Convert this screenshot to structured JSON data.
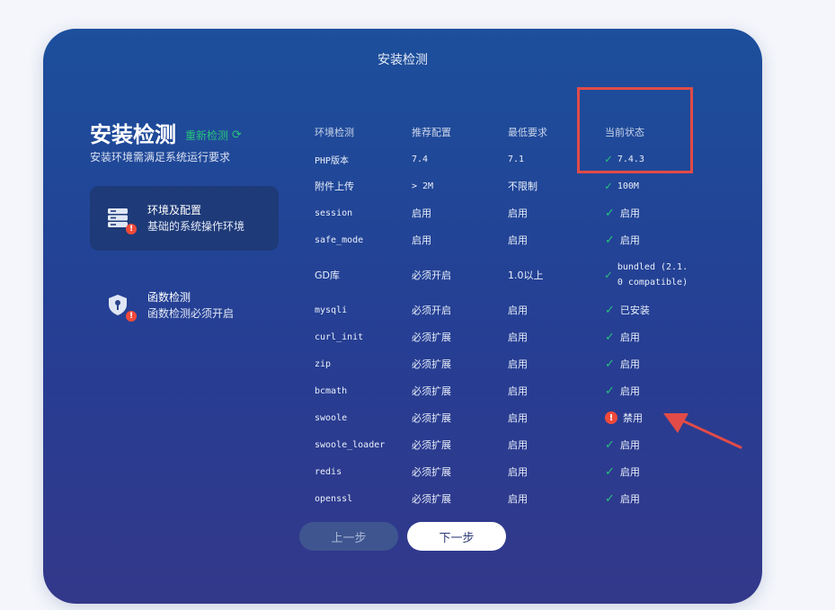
{
  "window_title": "安装检测",
  "main_title": "安装检测",
  "recheck_label": "重新检测",
  "recheck_icon": "refresh-icon",
  "subtitle": "安装环境需满足系统运行要求",
  "steps": [
    {
      "title": "环境及配置",
      "desc": "基础的系统操作环境",
      "icon": "server-icon",
      "active": true,
      "has_error": true
    },
    {
      "title": "函数检测",
      "desc": "函数检测必须开启",
      "icon": "shield-icon",
      "active": false,
      "has_error": true
    }
  ],
  "table": {
    "headers": [
      "环境检测",
      "推荐配置",
      "最低要求",
      "当前状态"
    ],
    "rows": [
      {
        "name": "PHP版本",
        "recommended": "7.4",
        "minimum": "7.1",
        "status": "7.4.3",
        "ok": true
      },
      {
        "name": "附件上传",
        "recommended": "> 2M",
        "minimum": "不限制",
        "status": "100M",
        "ok": true
      },
      {
        "name": "session",
        "recommended": "启用",
        "minimum": "启用",
        "status": "启用",
        "ok": true
      },
      {
        "name": "safe_mode",
        "recommended": "启用",
        "minimum": "启用",
        "status": "启用",
        "ok": true
      },
      {
        "name": "GD库",
        "recommended": "必须开启",
        "minimum": "1.0以上",
        "status_line1": "bundled (2.1.",
        "status_line2": "0 compatible)",
        "ok": true
      },
      {
        "name": "mysqli",
        "recommended": "必须开启",
        "minimum": "启用",
        "status": "已安装",
        "ok": true
      },
      {
        "name": "curl_init",
        "recommended": "必须扩展",
        "minimum": "启用",
        "status": "启用",
        "ok": true
      },
      {
        "name": "zip",
        "recommended": "必须扩展",
        "minimum": "启用",
        "status": "启用",
        "ok": true
      },
      {
        "name": "bcmath",
        "recommended": "必须扩展",
        "minimum": "启用",
        "status": "启用",
        "ok": true
      },
      {
        "name": "swoole",
        "recommended": "必须扩展",
        "minimum": "启用",
        "status": "禁用",
        "ok": false
      },
      {
        "name": "swoole_loader",
        "recommended": "必须扩展",
        "minimum": "启用",
        "status": "启用",
        "ok": true
      },
      {
        "name": "redis",
        "recommended": "必须扩展",
        "minimum": "启用",
        "status": "启用",
        "ok": true
      },
      {
        "name": "openssl",
        "recommended": "必须扩展",
        "minimum": "启用",
        "status": "启用",
        "ok": true
      }
    ]
  },
  "buttons": {
    "prev_label": "上一步",
    "next_label": "下一步"
  },
  "colors": {
    "accent_green": "#27c47d",
    "error_red": "#f04a3a",
    "annotation_red": "#e24b47"
  }
}
